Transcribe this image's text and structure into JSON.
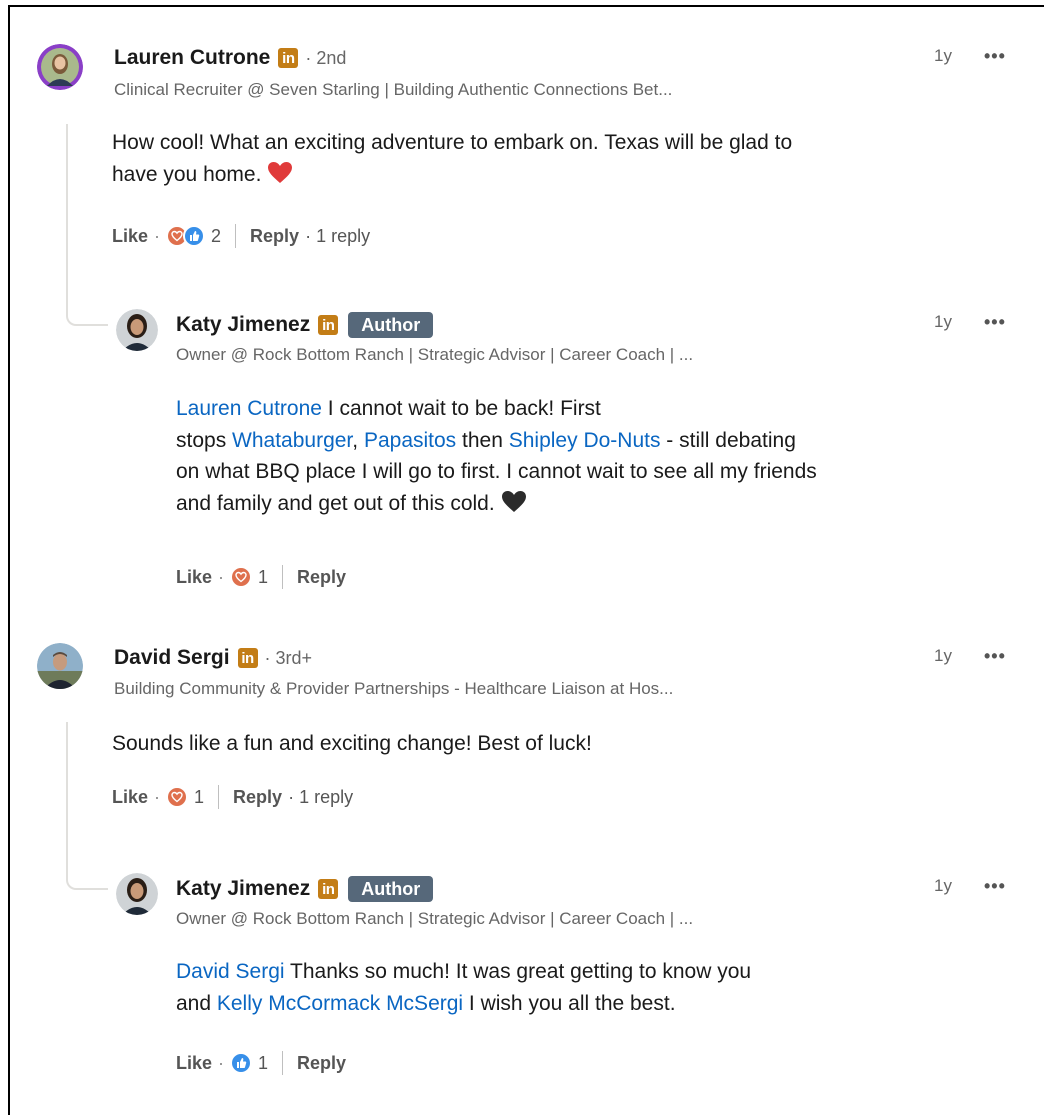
{
  "comments": [
    {
      "name": "Lauren Cutrone",
      "badge": "in",
      "degree": "· 2nd",
      "headline": "Clinical Recruiter @ Seven Starling | Building Authentic Connections Bet...",
      "time": "1y",
      "more": "•••",
      "text_1": "How cool! What an exciting adventure to embark on. Texas will be glad to",
      "text_2": "have you home.",
      "emoji": "❤️",
      "like": "Like",
      "dot": "·",
      "reactions": "2",
      "reply": "Reply",
      "reply_count": "· 1 reply",
      "avatar_color": "#8a3fc7"
    },
    {
      "name": "Katy Jimenez",
      "badge": "in",
      "author": "Author",
      "headline": "Owner @ Rock Bottom Ranch | Strategic Advisor | Career Coach | ...",
      "time": "1y",
      "more": "•••",
      "mention_1": "Lauren Cutrone",
      "text_1": " I cannot wait to be back! First",
      "text_2a": "stops ",
      "mention_2": "Whataburger",
      "text_2b": ", ",
      "mention_3": "Papasitos",
      "text_2c": " then ",
      "mention_4": "Shipley Do-Nuts",
      "text_2d": " - still debating",
      "text_3": "on what BBQ place I will go to first. I cannot wait to see all my friends",
      "text_4": "and family and get out of this cold.",
      "emoji": "🖤",
      "like": "Like",
      "dot": "·",
      "reactions": "1",
      "reply": "Reply"
    },
    {
      "name": "David Sergi",
      "badge": "in",
      "degree": "· 3rd+",
      "headline": "Building Community & Provider Partnerships - Healthcare Liaison at Hos...",
      "time": "1y",
      "more": "•••",
      "text_1": "Sounds like a fun and exciting change! Best of luck!",
      "like": "Like",
      "dot": "·",
      "reactions": "1",
      "reply": "Reply",
      "reply_count": "· 1 reply"
    },
    {
      "name": "Katy Jimenez",
      "badge": "in",
      "author": "Author",
      "headline": "Owner @ Rock Bottom Ranch | Strategic Advisor | Career Coach | ...",
      "time": "1y",
      "more": "•••",
      "mention_1": "David Sergi",
      "text_1": " Thanks so much! It was great getting to know you",
      "text_2a": "and ",
      "mention_2": "Kelly McCormack McSergi",
      "text_2b": " I wish you all the best.",
      "like": "Like",
      "dot": "·",
      "reactions": "1",
      "reply": "Reply"
    }
  ],
  "colors": {
    "mention": "#0a66c2",
    "linkedin_badge": "#c37d16",
    "author_tag": "#56687a",
    "love": "#df704d",
    "like": "#378fe9"
  }
}
